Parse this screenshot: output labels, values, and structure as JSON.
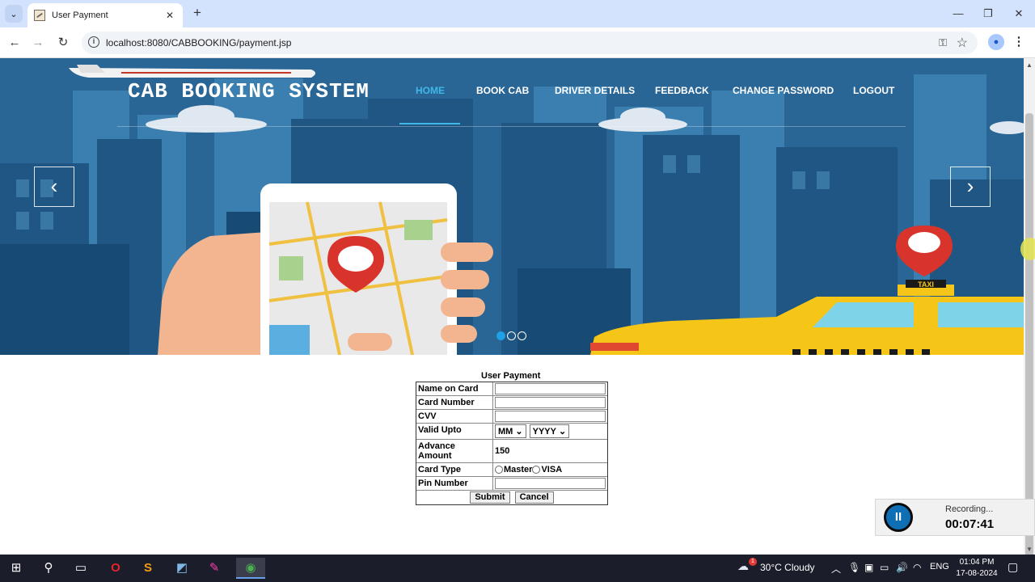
{
  "browser": {
    "tab_title": "User Payment",
    "tab_close": "✕",
    "new_tab": "+",
    "url": "localhost:8080/CABBOOKING/payment.jsp"
  },
  "site": {
    "logo": "CAB BOOKING SYSTEM",
    "nav": [
      "HOME",
      "BOOK CAB",
      "DRIVER DETAILS",
      "FEEDBACK",
      "CHANGE PASSWORD",
      "LOGOUT"
    ],
    "active_nav": "HOME",
    "hero_sign": "TAXI",
    "carousel_count": 3,
    "carousel_active": 1
  },
  "form": {
    "title": "User Payment",
    "labels": {
      "name": "Name on Card",
      "card": "Card Number",
      "cvv": "CVV",
      "valid": "Valid Upto",
      "amount": "Advance Amount",
      "type": "Card Type",
      "pin": "Pin Number"
    },
    "month_placeholder": "MM",
    "year_placeholder": "YYYY",
    "amount_value": "150",
    "card_types": [
      "Master",
      "VISA"
    ],
    "submit": "Submit",
    "cancel": "Cancel"
  },
  "recorder": {
    "status": "Recording...",
    "time": "00:07:41"
  },
  "taskbar": {
    "weather": "30°C  Cloudy",
    "weather_badge": "1",
    "lang": "ENG",
    "time": "01:04 PM",
    "date": "17-08-2024"
  }
}
